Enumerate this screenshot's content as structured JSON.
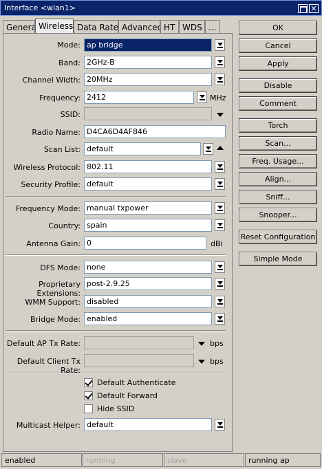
{
  "window": {
    "title": "Interface <wlan1>"
  },
  "tabs": [
    "General",
    "Wireless",
    "Data Rates",
    "Advanced",
    "HT",
    "WDS",
    "..."
  ],
  "form": {
    "mode": {
      "label": "Mode:",
      "value": "ap bridge"
    },
    "band": {
      "label": "Band:",
      "value": "2GHz-B"
    },
    "channel_width": {
      "label": "Channel Width:",
      "value": "20MHz"
    },
    "frequency": {
      "label": "Frequency:",
      "value": "2412",
      "unit": "MHz"
    },
    "ssid": {
      "label": "SSID:",
      "value": ""
    },
    "radio_name": {
      "label": "Radio Name:",
      "value": "D4CA6D4AF846"
    },
    "scan_list": {
      "label": "Scan List:",
      "value": "default"
    },
    "wireless_protocol": {
      "label": "Wireless Protocol:",
      "value": "802.11"
    },
    "security_profile": {
      "label": "Security Profile:",
      "value": "default"
    },
    "frequency_mode": {
      "label": "Frequency Mode:",
      "value": "manual txpower"
    },
    "country": {
      "label": "Country:",
      "value": "spain"
    },
    "antenna_gain": {
      "label": "Antenna Gain:",
      "value": "0",
      "unit": "dBi"
    },
    "dfs_mode": {
      "label": "DFS Mode:",
      "value": "none"
    },
    "proprietary_extensions": {
      "label": "Proprietary Extensions:",
      "value": "post-2.9.25"
    },
    "wmm_support": {
      "label": "WMM Support:",
      "value": "disabled"
    },
    "bridge_mode": {
      "label": "Bridge Mode:",
      "value": "enabled"
    },
    "default_ap_tx_rate": {
      "label": "Default AP Tx Rate:",
      "value": "",
      "unit": "bps"
    },
    "default_client_tx_rate": {
      "label": "Default Client Tx Rate:",
      "value": "",
      "unit": "bps"
    },
    "default_authenticate": {
      "label": "Default Authenticate",
      "checked": true
    },
    "default_forward": {
      "label": "Default Forward",
      "checked": true
    },
    "hide_ssid": {
      "label": "Hide SSID",
      "checked": false
    },
    "multicast_helper": {
      "label": "Multicast Helper:",
      "value": "default"
    }
  },
  "buttons": [
    "OK",
    "Cancel",
    "Apply",
    "Disable",
    "Comment",
    "Torch",
    "Scan...",
    "Freq. Usage...",
    "Align...",
    "Sniff...",
    "Snooper...",
    "Reset Configuration",
    "Simple Mode"
  ],
  "status_bar": [
    "enabled",
    "running",
    "slave",
    "running ap"
  ],
  "colors": {
    "title_bar": "#0a246a",
    "selection": "#0a246a",
    "window_bg": "#d4d0c8"
  }
}
